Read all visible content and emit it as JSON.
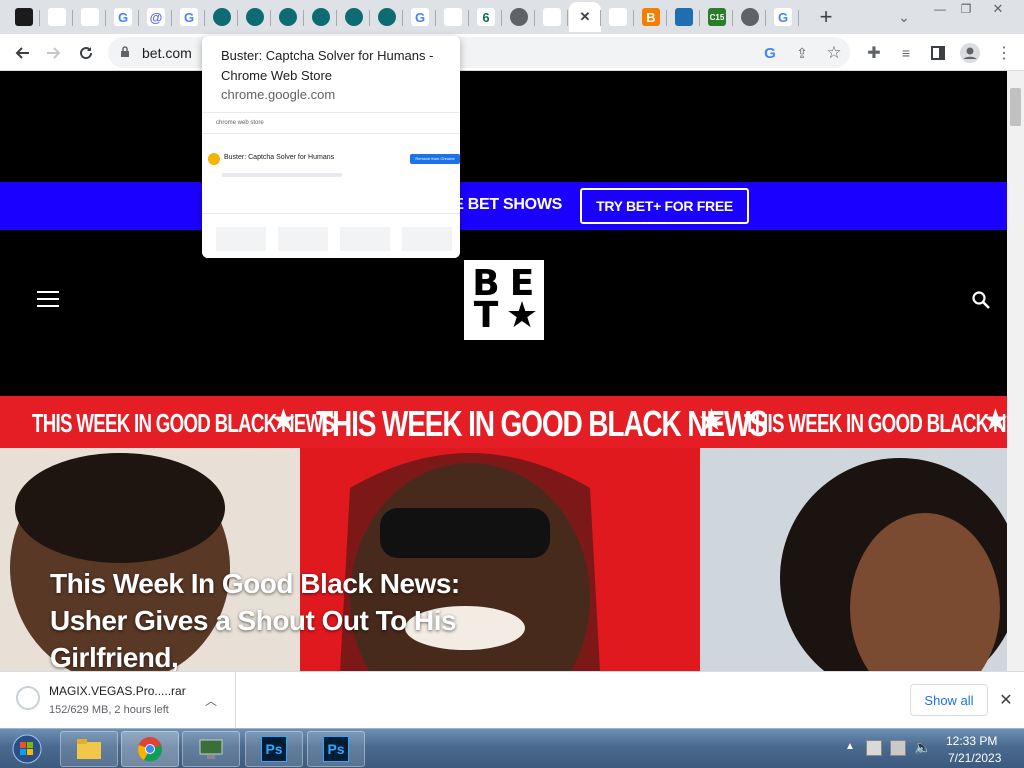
{
  "browser": {
    "tabs": [
      {
        "icon": "ps-gamepad-icon",
        "label": ""
      },
      {
        "icon": "olympics-icon",
        "label": ""
      },
      {
        "icon": "windows-store-icon",
        "label": ""
      },
      {
        "icon": "google-icon",
        "label": "G"
      },
      {
        "icon": "at-sign-icon",
        "label": "@"
      },
      {
        "icon": "google-icon",
        "label": "G"
      },
      {
        "icon": "robot-icon",
        "label": ""
      },
      {
        "icon": "robot-icon",
        "label": ""
      },
      {
        "icon": "robot-icon",
        "label": ""
      },
      {
        "icon": "robot-icon",
        "label": ""
      },
      {
        "icon": "robot-icon",
        "label": ""
      },
      {
        "icon": "robot-icon",
        "label": ""
      },
      {
        "icon": "google-icon",
        "label": "G"
      },
      {
        "icon": "clip-icon",
        "label": ""
      },
      {
        "icon": "six-icon",
        "label": "6"
      },
      {
        "icon": "globe-icon",
        "label": ""
      },
      {
        "icon": "molecule-icon",
        "label": ""
      },
      {
        "icon": "close-icon",
        "label": "✕"
      },
      {
        "icon": "drive-icon",
        "label": ""
      },
      {
        "icon": "blogger-icon",
        "label": "B"
      },
      {
        "icon": "telegram-icon",
        "label": ""
      },
      {
        "icon": "c15-icon",
        "label": "C15"
      },
      {
        "icon": "globe-icon",
        "label": ""
      },
      {
        "icon": "google-icon",
        "label": "G"
      }
    ],
    "new_tab_label": "+",
    "url": "bet.com",
    "hover_card": {
      "title": "Buster: Captcha Solver for Humans - Chrome Web Store",
      "domain": "chrome.google.com",
      "thumb_header": "chrome web store",
      "thumb_item_title": "Buster: Captcha Solver for Humans",
      "thumb_button": "Remove from Chrome"
    }
  },
  "page": {
    "promo_text": "E BET SHOWS",
    "promo_button": "TRY BET+ FOR FREE",
    "logo_letters": [
      "B",
      "E",
      "T",
      "★"
    ],
    "banner_main": "THIS WEEK IN GOOD BLACK NEWS",
    "banner_left": "THIS WEEK IN GOOD BLACK NEWS",
    "banner_right": "THIS WEEK IN GOOD BLACK NEWS",
    "headline": "This Week In Good Black News: Usher Gives a Shout Out To His Girlfriend,"
  },
  "download": {
    "file_name": "MAGIX.VEGAS.Pro.....rar",
    "status": "152/629 MB, 2 hours left",
    "show_all": "Show all"
  },
  "taskbar": {
    "time": "12:33 PM",
    "date": "7/21/2023",
    "ps_label": "Ps"
  },
  "colors": {
    "promo_bg": "#1a00ff",
    "banner_bg": "#e51e25",
    "accent_blue": "#1a73e8"
  }
}
